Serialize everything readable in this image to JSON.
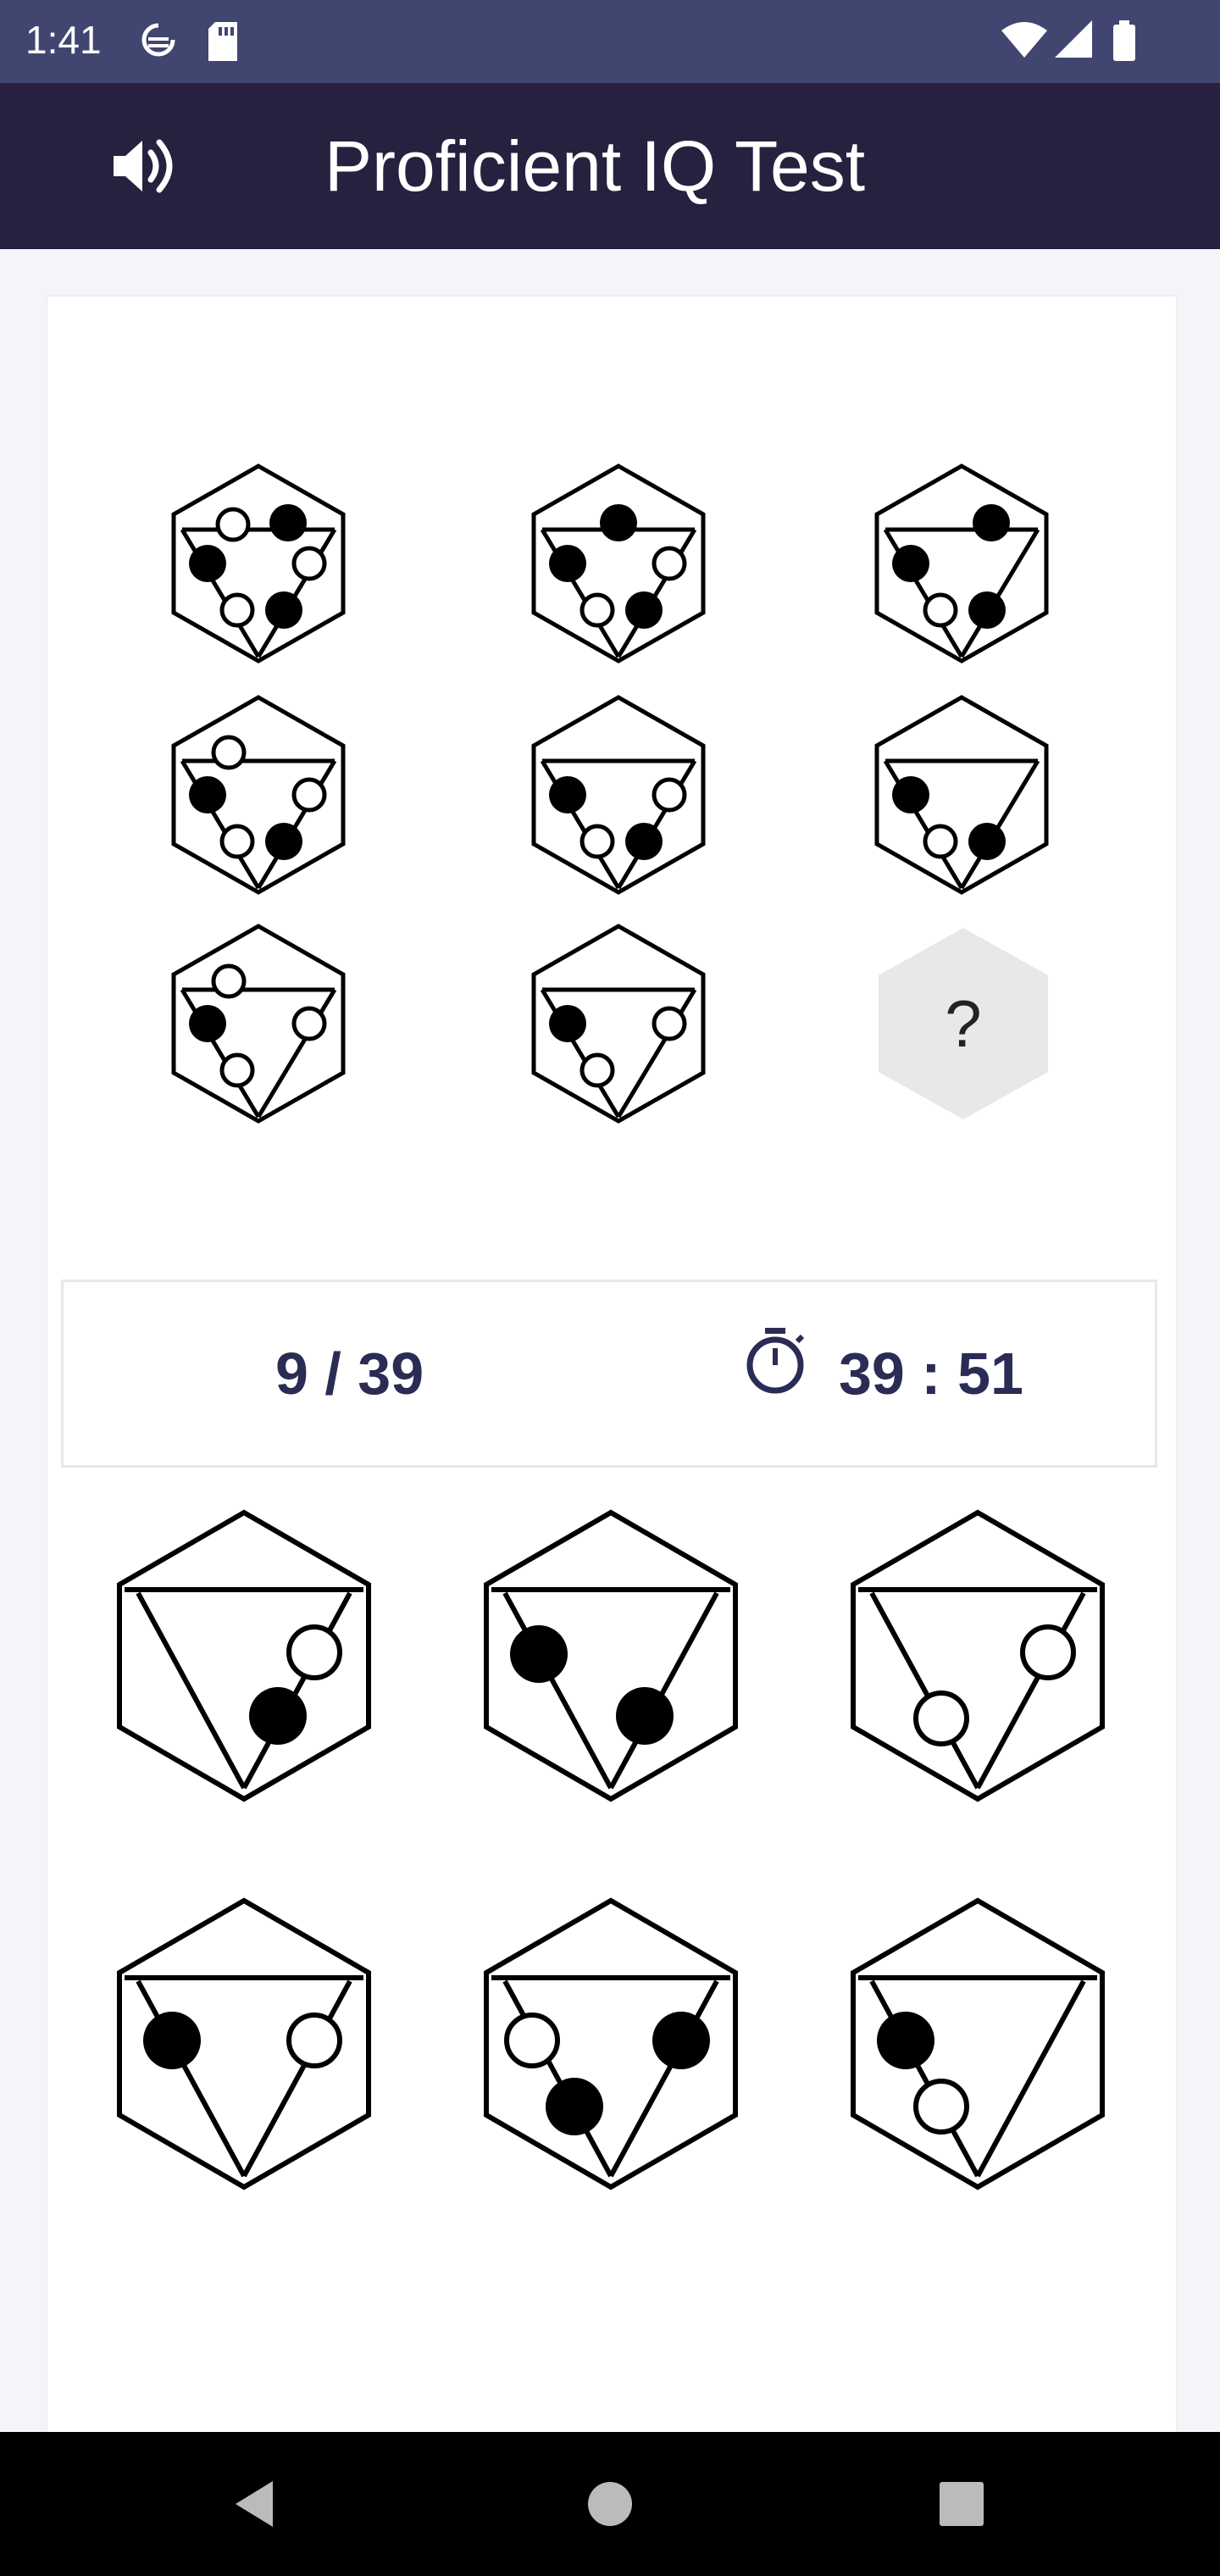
{
  "status_bar": {
    "time": "1:41",
    "icons": [
      "sync-icon",
      "sd-card-icon",
      "wifi-icon",
      "signal-icon",
      "battery-icon"
    ]
  },
  "app_bar": {
    "title": "Proficient IQ Test",
    "sound_icon": "volume-icon"
  },
  "puzzle": {
    "question_mark": "?"
  },
  "info": {
    "progress": "9 / 39",
    "timer": "39 : 51",
    "timer_icon": "stopwatch-icon"
  },
  "answer_options_count": 6,
  "nav_bar": {
    "icons": [
      "back-icon",
      "home-icon",
      "recents-icon"
    ]
  },
  "colors": {
    "status_bar": "#404670",
    "app_bar": "#27203f",
    "accent_text": "#2b2c55",
    "question_fill": "#e8e8e8"
  }
}
